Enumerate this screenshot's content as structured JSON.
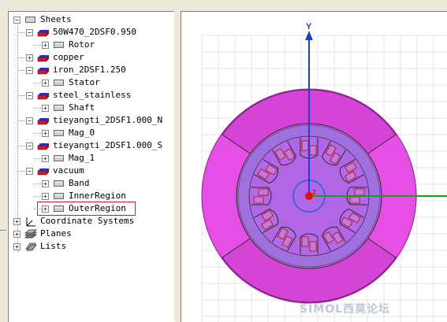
{
  "tree": {
    "root": "Sheets",
    "items": [
      {
        "label": "50W470_2DSF0.950",
        "level": 1,
        "expander": "−",
        "icon": "material-sheet-icon"
      },
      {
        "label": "Rotor",
        "level": 2,
        "expander": "+",
        "icon": "sheet-object-icon"
      },
      {
        "label": "copper",
        "level": 1,
        "expander": "+",
        "icon": "material-sheet-icon"
      },
      {
        "label": "iron_2DSF1.250",
        "level": 1,
        "expander": "−",
        "icon": "material-sheet-icon"
      },
      {
        "label": "Stator",
        "level": 2,
        "expander": "+",
        "icon": "sheet-object-icon"
      },
      {
        "label": "steel_stainless",
        "level": 1,
        "expander": "−",
        "icon": "material-sheet-icon"
      },
      {
        "label": "Shaft",
        "level": 2,
        "expander": "+",
        "icon": "sheet-object-icon"
      },
      {
        "label": "tieyangti_2DSF1.000_N",
        "level": 1,
        "expander": "−",
        "icon": "material-sheet-icon"
      },
      {
        "label": "Mag_0",
        "level": 2,
        "expander": "+",
        "icon": "sheet-object-icon"
      },
      {
        "label": "tieyangti_2DSF1.000_S",
        "level": 1,
        "expander": "−",
        "icon": "material-sheet-icon"
      },
      {
        "label": "Mag_1",
        "level": 2,
        "expander": "+",
        "icon": "sheet-object-icon"
      },
      {
        "label": "vacuum",
        "level": 1,
        "expander": "−",
        "icon": "material-sheet-icon"
      },
      {
        "label": "Band",
        "level": 2,
        "expander": "+",
        "icon": "sheet-object-icon"
      },
      {
        "label": "InnerRegion",
        "level": 2,
        "expander": "+",
        "icon": "sheet-object-icon"
      },
      {
        "label": "OuterRegion",
        "level": 2,
        "expander": "+",
        "icon": "sheet-object-icon",
        "selected": true
      }
    ],
    "top_nodes": [
      {
        "label": "Coordinate Systems",
        "icon": "coordinate-axes-icon"
      },
      {
        "label": "Planes",
        "icon": "planes-icon"
      },
      {
        "label": "Lists",
        "icon": "lists-icon"
      }
    ]
  },
  "viewport": {
    "axis_y_label": "Y",
    "axis_z_label": "Z",
    "colors": {
      "magenta": "#e64fe6",
      "violet": "#a070e0",
      "axis_blue": "#1f3fd0",
      "axis_green": "#1a9a1a",
      "selection": "#c8202a"
    }
  },
  "watermark": "SIMOL西莫论坛"
}
